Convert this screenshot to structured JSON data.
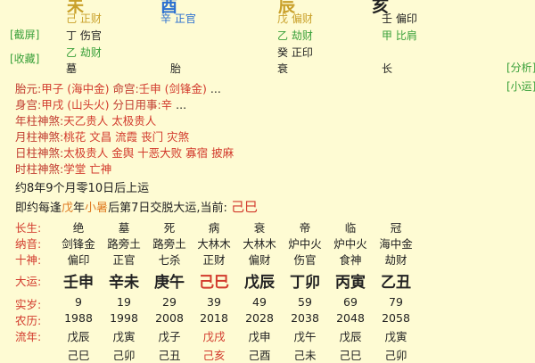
{
  "pillars": {
    "top_stems": [
      "未",
      "酉",
      "辰",
      "亥"
    ],
    "stem_row": [
      {
        "text": "己 正财",
        "color": "#c9a02a"
      },
      {
        "text": "辛 正官",
        "color": "#2a6fd0"
      },
      {
        "text": "戊 偏财",
        "color": "#c9a02a"
      },
      {
        "text": "壬 偏印",
        "color": "#222222"
      }
    ],
    "sub_row1": [
      {
        "text": "丁 伤官",
        "color": "#222222"
      },
      {
        "text": "乙 劫财",
        "color": "#3aa03a"
      },
      {
        "text": "甲 比肩",
        "color": "#3aa03a"
      }
    ],
    "sub_row2": [
      {
        "text": "乙 劫财",
        "color": "#3aa03a"
      },
      {
        "text": "癸 正印",
        "color": "#222222"
      }
    ],
    "stage_row": [
      "墓",
      "胎",
      "衰",
      "长"
    ]
  },
  "side_buttons": {
    "jieping": "[截屏]",
    "shoucang": "[收藏]",
    "fenxi": "[分析]",
    "xiaoyun": "[小运]"
  },
  "info": {
    "taiyuan_label": "胎元:",
    "taiyuan_value": "甲子 (海中金)",
    "minggong_label": "命宫:",
    "minggong_value": "壬申 (剑锋金)",
    "ellipsis1": "...",
    "shengong_label": "身宫:",
    "shengong_value": "甲戌 (山头火)",
    "fenri_label": "分日用事:",
    "fenri_value": "辛",
    "ellipsis2": "...",
    "nian_label": "年柱神煞:",
    "nian_value": "天乙贵人 太极贵人",
    "yue_label": "月柱神煞:",
    "yue_value": "桃花 文昌 流霞 丧门 灾煞",
    "ri_label": "日柱神煞:",
    "ri_value": "太极贵人 金舆 十恶大败 寡宿 披麻",
    "shi_label": "时柱神煞:",
    "shi_value": "学堂 亡神"
  },
  "yun": {
    "qiyun": "约8年9个月零10日后上运",
    "jiaoyun_prefix": "即约每逢",
    "jiaoyun_wu": "戊",
    "jiaoyun_nian": "年",
    "jiaoyun_xiaoshu": "小暑",
    "jiaoyun_suffix": "后第7日交脱大运,当前:",
    "current": "己巳"
  },
  "grid": {
    "labels": [
      "长生:",
      "纳音:",
      "十神:",
      "大运:",
      "实岁:",
      "农历:",
      "流年:"
    ],
    "changsheng": [
      "绝",
      "墓",
      "死",
      "病",
      "衰",
      "帝",
      "临",
      "冠"
    ],
    "nayin": [
      "剑锋金",
      "路旁土",
      "路旁土",
      "大林木",
      "大林木",
      "炉中火",
      "炉中火",
      "海中金"
    ],
    "shishen": [
      "偏印",
      "正官",
      "七杀",
      "正财",
      "偏财",
      "伤官",
      "食神",
      "劫财"
    ],
    "dayun": [
      "壬申",
      "辛未",
      "庚午",
      "己巳",
      "戊辰",
      "丁卯",
      "丙寅",
      "乙丑"
    ],
    "shisui": [
      "9",
      "19",
      "29",
      "39",
      "49",
      "59",
      "69",
      "79"
    ],
    "nongli": [
      "1988",
      "1998",
      "2008",
      "2018",
      "2028",
      "2038",
      "2048",
      "2058"
    ],
    "liunian": [
      "戊辰",
      "戊寅",
      "戊子",
      "戊戌",
      "戊申",
      "戊午",
      "戊辰",
      "戊寅"
    ],
    "liunian2": [
      "己巳",
      "己卯",
      "己丑",
      "己亥",
      "己酉",
      "己未",
      "己巳",
      "己卯"
    ]
  },
  "colors": {
    "background": "#fefbd3",
    "label_red": "#d23a2c",
    "gold": "#c9a02a",
    "blue": "#2a6fd0",
    "green": "#3aa03a",
    "orange": "#e07b22"
  }
}
